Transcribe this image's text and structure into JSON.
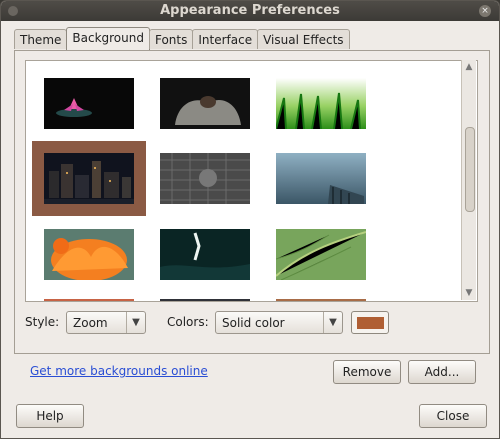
{
  "window": {
    "title": "Appearance Preferences"
  },
  "tabs": [
    {
      "label": "Theme"
    },
    {
      "label": "Background"
    },
    {
      "label": "Fonts"
    },
    {
      "label": "Interface"
    },
    {
      "label": "Visual Effects"
    }
  ],
  "controls": {
    "style_label": "Style:",
    "style_value": "Zoom",
    "colors_label": "Colors:",
    "colors_value": "Solid color",
    "swatch_color": "#b05f34",
    "link": "Get more backgrounds online",
    "remove_label": "Remove",
    "add_label": "Add...",
    "help_label": "Help",
    "close_label": "Close"
  },
  "gallery": [
    {
      "name": "lotus"
    },
    {
      "name": "cupped-hands"
    },
    {
      "name": "green-grass"
    },
    {
      "name": "city-night"
    },
    {
      "name": "stone-wall"
    },
    {
      "name": "misty-dock"
    },
    {
      "name": "orange-flower"
    },
    {
      "name": "dark-water"
    },
    {
      "name": "green-leaf"
    }
  ]
}
